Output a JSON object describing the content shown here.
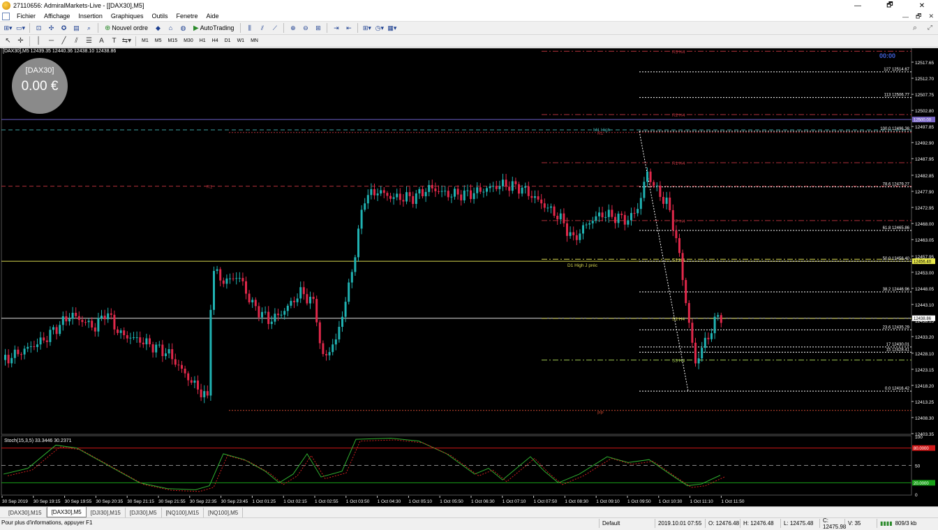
{
  "window": {
    "title": "27110656: AdmiralMarkets-Live - [[DAX30],M5]",
    "controls": [
      "—",
      "🗗",
      "✕"
    ]
  },
  "menu": [
    "Fichier",
    "Affichage",
    "Insertion",
    "Graphiques",
    "Outils",
    "Fenetre",
    "Aide"
  ],
  "toolbar": {
    "new_order": "Nouvel ordre",
    "autotrading": "AutoTrading"
  },
  "timeframes": [
    "M1",
    "M5",
    "M15",
    "M30",
    "H1",
    "H4",
    "D1",
    "W1",
    "MN"
  ],
  "chart": {
    "symbol_header": "[DAX30],M5  12439.35 12440.36 12438.10 12438.86",
    "balance": {
      "symbol": "[DAX30]",
      "value": "0.00 €"
    },
    "timer": "00:00",
    "price_axis": [
      "12517.65",
      "12512.70",
      "12507.75",
      "12502.80",
      "12497.85",
      "12492.90",
      "12487.95",
      "12482.85",
      "12477.90",
      "12472.95",
      "12468.00",
      "12463.05",
      "12457.95",
      "12453.00",
      "12448.05",
      "12443.10",
      "12438.15",
      "12433.20",
      "12428.10",
      "12423.15",
      "12418.20",
      "12413.25",
      "12408.30",
      "12403.35"
    ],
    "price_tags": [
      {
        "label": "12500.00",
        "color": "#7b68c8"
      },
      {
        "label": "12456.40",
        "color": "#e8e84a"
      },
      {
        "label": "12438.86",
        "color": "#ffffff"
      }
    ],
    "fib_labels": [
      {
        "level": "127",
        "price": "12514.67"
      },
      {
        "level": "113",
        "price": "12506.77"
      },
      {
        "level": "100.0",
        "price": "12496.38"
      },
      {
        "level": "78.6",
        "price": "12479.27"
      },
      {
        "level": "61.8",
        "price": "12465.86"
      },
      {
        "level": "50.0",
        "price": "12456.40"
      },
      {
        "level": "38.2",
        "price": "12446.96"
      },
      {
        "level": "23.6",
        "price": "12435.29"
      },
      {
        "level": "17",
        "price": "12430.01"
      },
      {
        "level": "15",
        "price": "12428.41"
      },
      {
        "level": "0.0",
        "price": "12416.42"
      }
    ],
    "pivot_labels": [
      "R3 H4",
      "R2 H4",
      "R1 H4",
      "PP H4",
      "S1 H4",
      "S2 H4",
      "S3 H4",
      "R1",
      "R1",
      "PP",
      "M1 High",
      "D1 High J préc"
    ],
    "time_axis": [
      "30 Sep 2019",
      "30 Sep 19:15",
      "30 Sep 19:55",
      "30 Sep 20:35",
      "30 Sep 21:15",
      "30 Sep 21:55",
      "30 Sep 22:35",
      "30 Sep 23:45",
      "1 Oct 01:25",
      "1 Oct 02:15",
      "1 Oct 02:55",
      "1 Oct 03:50",
      "1 Oct 04:30",
      "1 Oct 05:10",
      "1 Oct 05:50",
      "1 Oct 06:30",
      "1 Oct 07:10",
      "1 Oct 07:50",
      "1 Oct 08:30",
      "1 Oct 09:10",
      "1 Oct 09:50",
      "1 Oct 10:30",
      "1 Oct 11:10",
      "1 Oct 11:50"
    ],
    "oscillator": {
      "header": "Stoch(15,3,5) 33.3446 30.2371",
      "axis": [
        "100",
        "50",
        "0"
      ],
      "tags": [
        {
          "label": "80.0000",
          "color": "#d01818"
        },
        {
          "label": "20.0000",
          "color": "#18a018"
        }
      ]
    }
  },
  "tabs": [
    "[DAX30],M15",
    "[DAX30],M5",
    "[DJI30],M15",
    "[DJI30],M5",
    "[NQ100],M15",
    "[NQ100],M5"
  ],
  "active_tab": "[DAX30],M5",
  "status": {
    "help": "Pour plus d'informations, appuyer F1",
    "profile": "Default",
    "datetime": "2019.10.01 07:55",
    "open": "O: 12476.48",
    "high": "H: 12476.48",
    "low": "L: 12475.48",
    "close": "C: 12475.98",
    "volume": "V: 35",
    "traffic": "809/3 kb"
  },
  "colors": {
    "bull": "#20b2b2",
    "bear": "#e0284a",
    "background": "#000000"
  },
  "icons": [
    "app-logo-icon",
    "new-chart-icon",
    "profiles-icon",
    "zoom-in-icon",
    "zoom-out-icon",
    "crosshair-icon",
    "cursor-icon",
    "line-icon",
    "trendline-icon",
    "fibonacci-icon",
    "text-icon",
    "search-icon",
    "expand-icon"
  ]
}
